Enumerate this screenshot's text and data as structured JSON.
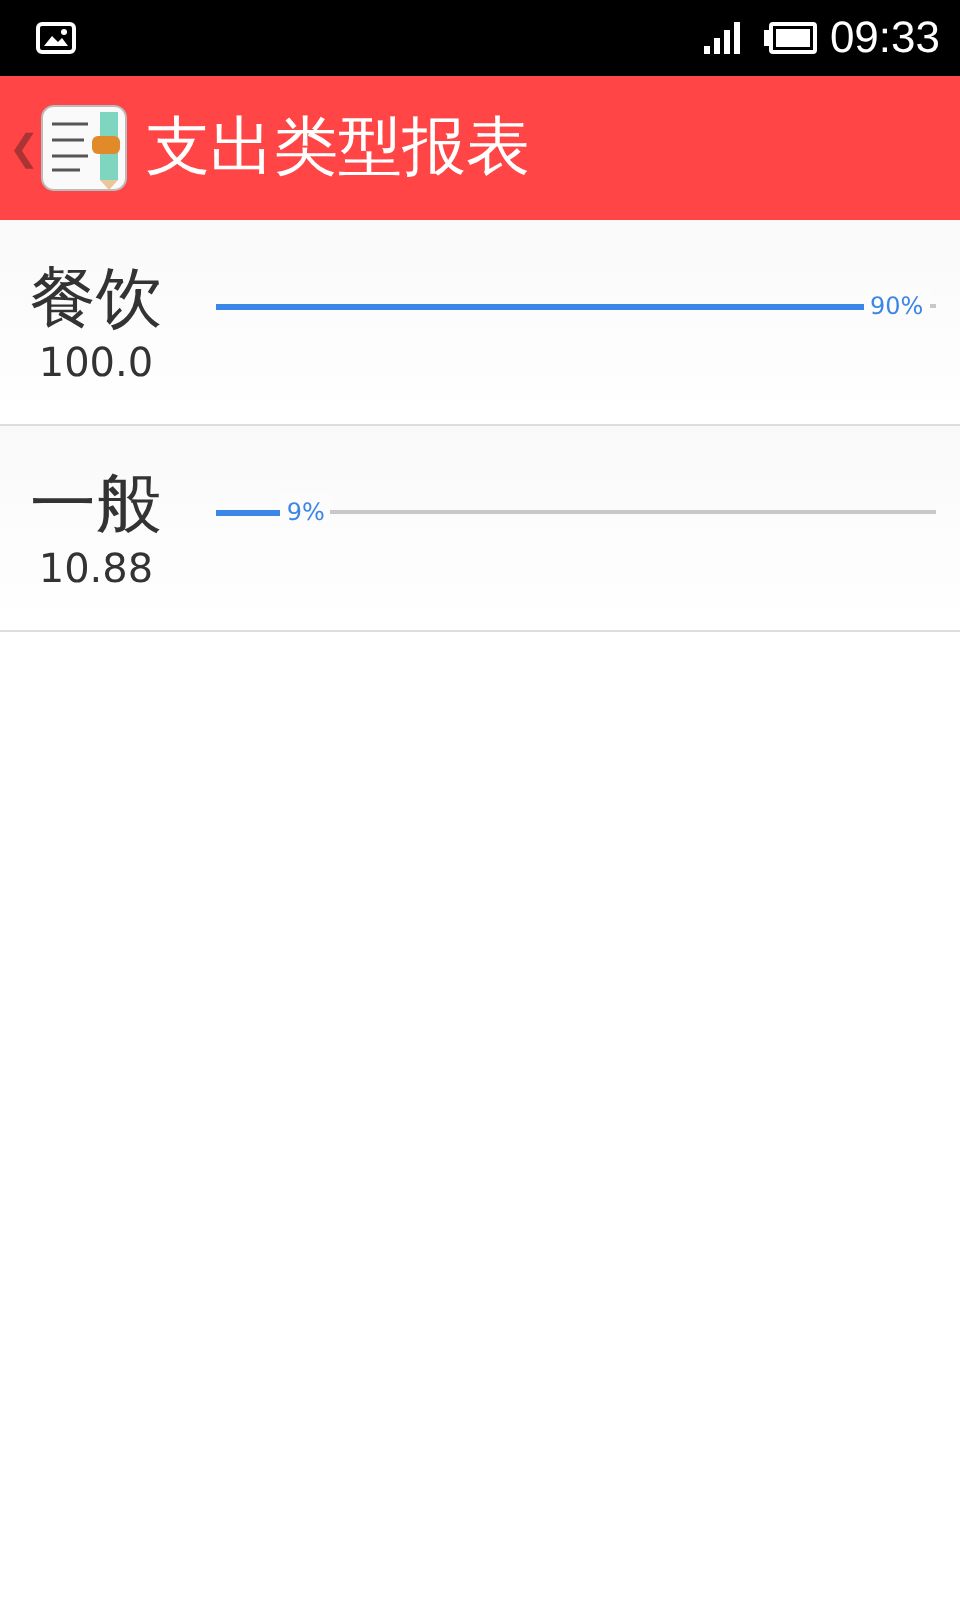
{
  "status_bar": {
    "time": "09:33"
  },
  "app_bar": {
    "back": "❮",
    "title": "支出类型报表"
  },
  "rows": [
    {
      "name": "餐饮",
      "amount": "100.0",
      "level": 0.9,
      "percent": "90%"
    },
    {
      "name": "一般",
      "amount": "10.88",
      "level": 0.09,
      "percent": "9%"
    }
  ]
}
